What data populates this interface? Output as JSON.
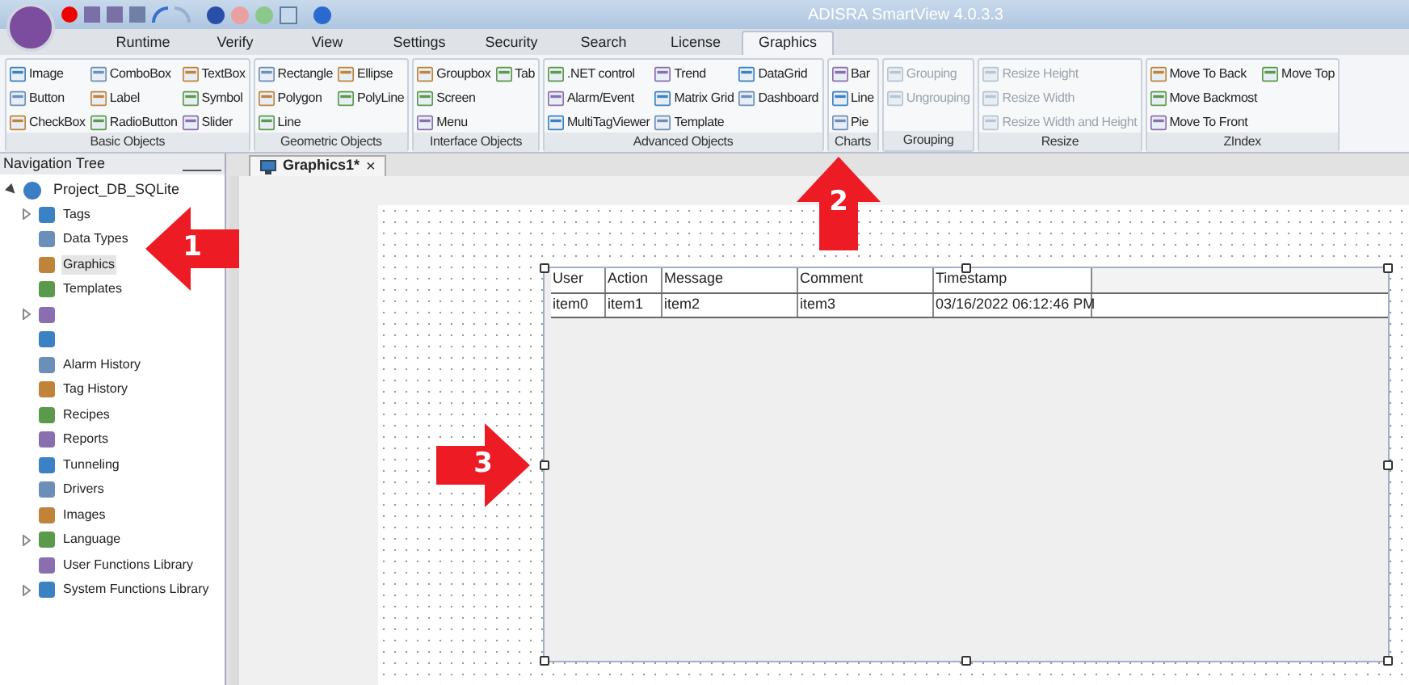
{
  "window": {
    "title": "ADISRA SmartView 4.0.3.3"
  },
  "menu_tabs": [
    {
      "label": "Runtime",
      "selected": false
    },
    {
      "label": "Verify",
      "selected": false
    },
    {
      "label": "View",
      "selected": false
    },
    {
      "label": "Settings",
      "selected": false
    },
    {
      "label": "Security",
      "selected": false
    },
    {
      "label": "Search",
      "selected": false
    },
    {
      "label": "License",
      "selected": false
    },
    {
      "label": "Graphics",
      "selected": true
    }
  ],
  "ribbon_groups": [
    {
      "title": "Basic Objects",
      "columns": [
        [
          {
            "label": "Image",
            "disabled": false
          },
          {
            "label": "Button",
            "disabled": false
          },
          {
            "label": "CheckBox",
            "disabled": false
          }
        ],
        [
          {
            "label": "ComboBox",
            "disabled": false
          },
          {
            "label": "Label",
            "disabled": false
          },
          {
            "label": "RadioButton",
            "disabled": false
          }
        ],
        [
          {
            "label": "TextBox",
            "disabled": false
          },
          {
            "label": "Symbol",
            "disabled": false
          },
          {
            "label": "Slider",
            "disabled": false
          }
        ]
      ]
    },
    {
      "title": "Geometric Objects",
      "columns": [
        [
          {
            "label": "Rectangle",
            "disabled": false
          },
          {
            "label": "Polygon",
            "disabled": false
          },
          {
            "label": "Line",
            "disabled": false
          }
        ],
        [
          {
            "label": "Ellipse",
            "disabled": false
          },
          {
            "label": "PolyLine",
            "disabled": false
          }
        ]
      ]
    },
    {
      "title": "Interface Objects",
      "columns": [
        [
          {
            "label": "Groupbox",
            "disabled": false
          },
          {
            "label": "Screen",
            "disabled": false
          },
          {
            "label": "Menu",
            "disabled": false
          }
        ],
        [
          {
            "label": "Tab",
            "disabled": false
          }
        ]
      ]
    },
    {
      "title": "Advanced Objects",
      "columns": [
        [
          {
            "label": ".NET control",
            "disabled": false
          },
          {
            "label": "Alarm/Event",
            "disabled": false
          },
          {
            "label": "MultiTagViewer",
            "disabled": false
          }
        ],
        [
          {
            "label": "Trend",
            "disabled": false
          },
          {
            "label": "Matrix Grid",
            "disabled": false
          },
          {
            "label": "Template",
            "disabled": false
          }
        ],
        [
          {
            "label": "DataGrid",
            "disabled": false
          },
          {
            "label": "Dashboard",
            "disabled": false
          }
        ]
      ]
    },
    {
      "title": "Charts",
      "columns": [
        [
          {
            "label": "Bar",
            "disabled": false
          },
          {
            "label": "Line",
            "disabled": false
          },
          {
            "label": "Pie",
            "disabled": false
          }
        ]
      ]
    },
    {
      "title": "Grouping",
      "columns": [
        [
          {
            "label": "Grouping",
            "disabled": true
          },
          {
            "label": "Ungrouping",
            "disabled": true
          }
        ]
      ]
    },
    {
      "title": "Resize",
      "columns": [
        [
          {
            "label": "Resize Height",
            "disabled": true
          },
          {
            "label": "Resize Width",
            "disabled": true
          },
          {
            "label": "Resize Width and Height",
            "disabled": true
          }
        ]
      ]
    },
    {
      "title": "ZIndex",
      "columns": [
        [
          {
            "label": "Move To Back",
            "disabled": false
          },
          {
            "label": "Move Backmost",
            "disabled": false
          },
          {
            "label": "Move To Front",
            "disabled": false
          }
        ],
        [
          {
            "label": "Move Top",
            "disabled": false
          }
        ]
      ]
    }
  ],
  "navigation_tree": {
    "title": "Navigation Tree",
    "root": {
      "label": "Project_DB_SQLite",
      "expanded": true,
      "children": [
        {
          "label": "Tags",
          "expandable": true,
          "selected": false
        },
        {
          "label": "Data Types",
          "selected": false
        },
        {
          "label": "Graphics",
          "selected": true
        },
        {
          "label": "Templates",
          "selected": false
        },
        {
          "expandable": true,
          "selected": false
        },
        {
          "selected": false
        },
        {
          "label": "Alarm History",
          "selected": false
        },
        {
          "label": "Tag History",
          "selected": false
        },
        {
          "label": "Recipes",
          "selected": false
        },
        {
          "label": "Reports",
          "selected": false
        },
        {
          "label": "Tunneling",
          "selected": false
        },
        {
          "label": "Drivers",
          "selected": false
        },
        {
          "label": "Images",
          "selected": false
        },
        {
          "label": "Language",
          "expandable": true,
          "selected": false
        },
        {
          "label": "User Functions Library",
          "selected": false
        },
        {
          "label": "System Functions Library",
          "expandable": true,
          "selected": false
        }
      ]
    }
  },
  "document_tab": {
    "label": "Graphics1*",
    "close": "×"
  },
  "data_grid": {
    "columns": [
      "User",
      "Action",
      "Message",
      "Comment",
      "Timestamp"
    ],
    "rows": [
      [
        "item0",
        "item1",
        "item2",
        "item3",
        "03/16/2022 06:12:46 PM"
      ]
    ]
  },
  "annotations": [
    {
      "label": "1"
    },
    {
      "label": "2"
    },
    {
      "label": "3"
    }
  ]
}
